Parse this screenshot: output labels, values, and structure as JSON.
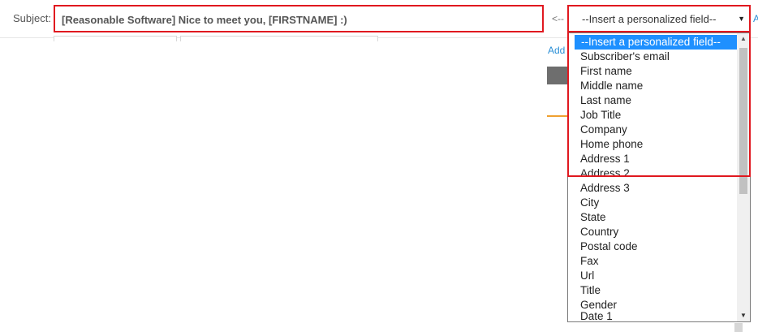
{
  "subject": {
    "label": "Subject:",
    "value": "[Reasonable Software] Nice to meet you, [FIRSTNAME] :)"
  },
  "arrow_hint": "<--",
  "personalized_select": {
    "selected": "--Insert a personalized field--",
    "options": [
      "--Insert a personalized field--",
      "Subscriber's email",
      "First name",
      "Middle name",
      "Last name",
      "Job Title",
      "Company",
      "Home phone",
      "Address 1",
      "Address 2",
      "Address 3",
      "City",
      "State",
      "Country",
      "Postal code",
      "Fax",
      "Url",
      "Title",
      "Gender",
      "Date 1"
    ]
  },
  "links": {
    "add_label": "Add",
    "far_right_label": "A"
  },
  "colors": {
    "highlight_border": "#e0181f",
    "selected_option_bg": "#1e90ff",
    "link": "#2a8fd6",
    "accent_orange": "#f0a030"
  }
}
